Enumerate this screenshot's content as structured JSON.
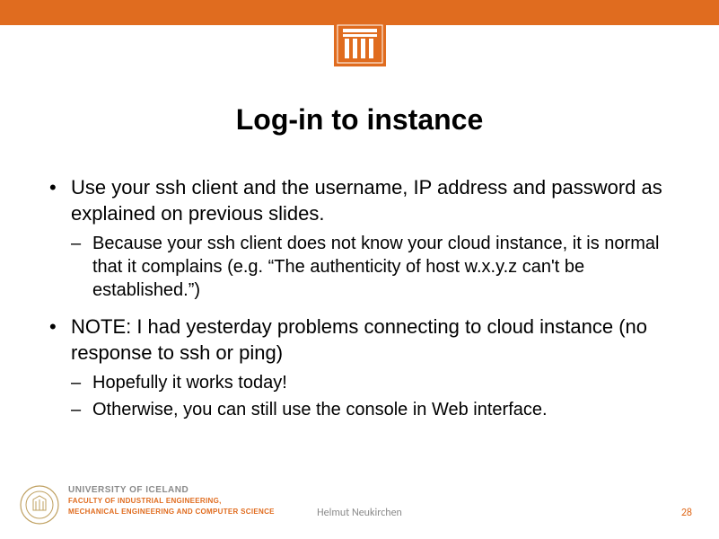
{
  "slide": {
    "title": "Log-in to instance",
    "bullets": [
      {
        "text": "Use your ssh client and the username, IP address and password as explained on previous slides.",
        "sub": [
          "Because your ssh client does not know your cloud instance, it is normal that it complains (e.g. “The authenticity of host w.x.y.z can't be established.”)"
        ]
      },
      {
        "text": "NOTE: I had yesterday problems connecting to cloud instance (no response to ssh or ping)",
        "sub": [
          "Hopefully it works today!",
          "Otherwise, you can still use the console in Web interface."
        ]
      }
    ]
  },
  "footer": {
    "university": "UNIVERSITY OF ICELAND",
    "faculty_line1": "FACULTY OF INDUSTRIAL ENGINEERING,",
    "faculty_line2": "MECHANICAL ENGINEERING AND COMPUTER SCIENCE",
    "author": "Helmut Neukirchen",
    "page": "28"
  },
  "colors": {
    "accent": "#e06c1f"
  }
}
